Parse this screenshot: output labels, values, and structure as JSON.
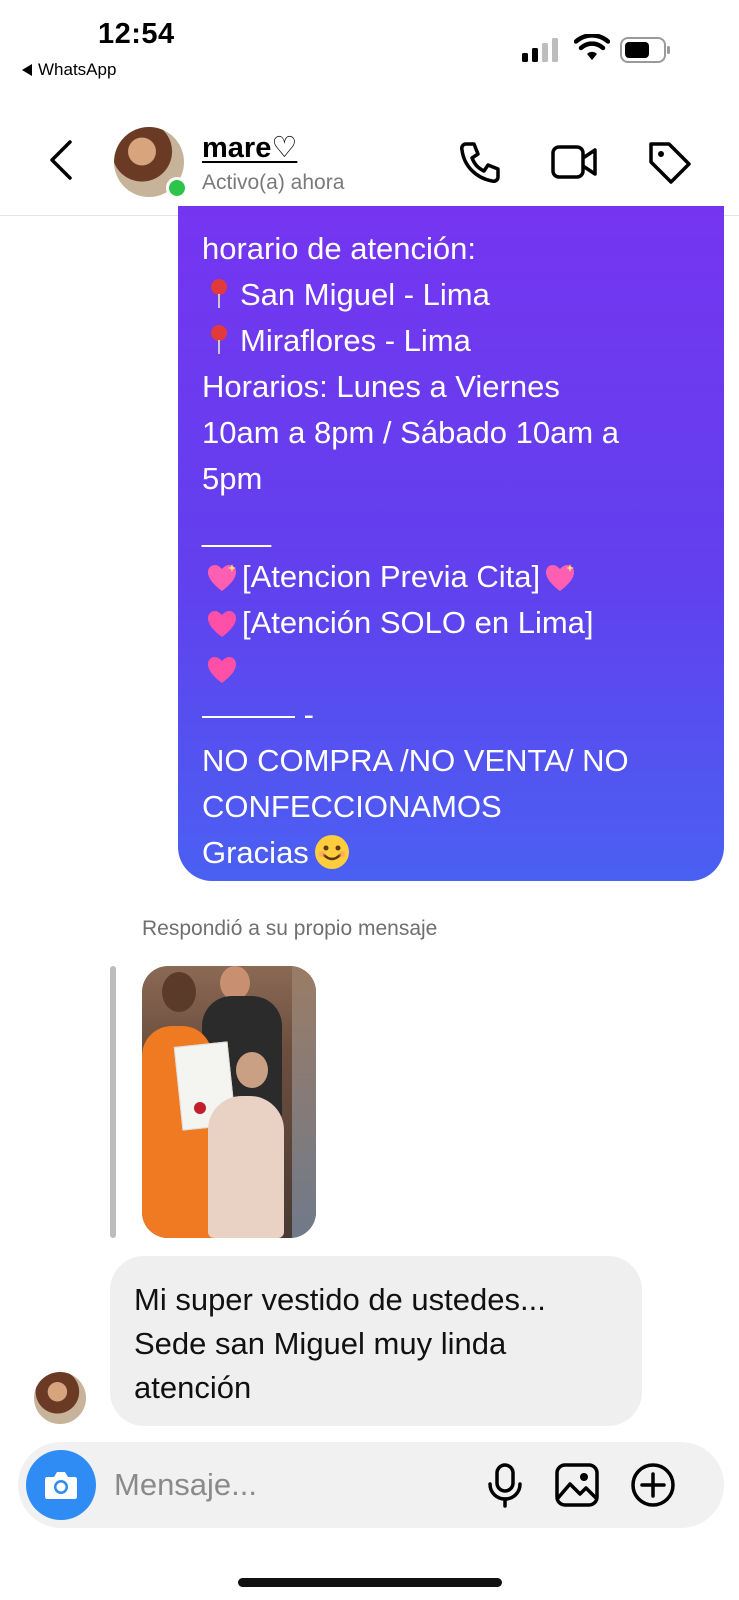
{
  "status_bar": {
    "time": "12:54",
    "back_app": "WhatsApp"
  },
  "header": {
    "contact_name": "mare♡",
    "contact_status": "Activo(a) ahora",
    "icons": [
      "chevron-left-icon",
      "phone-icon",
      "video-camera-icon",
      "tag-icon"
    ]
  },
  "conversation": {
    "sent_message": {
      "line1": "horario de atención:",
      "line2": "San Miguel - Lima",
      "line3": "Miraflores - Lima",
      "line4": "Horarios: Lunes a Viernes\n10am a 8pm / Sábado 10am a\n5pm",
      "sep1": "____",
      "line5": "[Atencion Previa Cita]",
      "line6": "[Atención SOLO en Lima]",
      "sep2": "——— -",
      "line7": "NO COMPRA /NO VENTA/ NO\nCONFECCIONAMOS",
      "line8": "Gracias"
    },
    "reply_label": "Respondió a su propio mensaje",
    "received_message": "Mi super vestido de ustedes...\nSede san Miguel muy linda\natención"
  },
  "composer": {
    "placeholder": "Mensaje...",
    "icons": [
      "camera-icon",
      "microphone-icon",
      "image-icon",
      "plus-circle-icon"
    ]
  },
  "colors": {
    "sent_gradient_top": "#7535f0",
    "sent_gradient_bottom": "#4a60f2",
    "received_bubble": "#efefef",
    "online": "#2ec44a",
    "camera_button": "#2f8cf5"
  }
}
